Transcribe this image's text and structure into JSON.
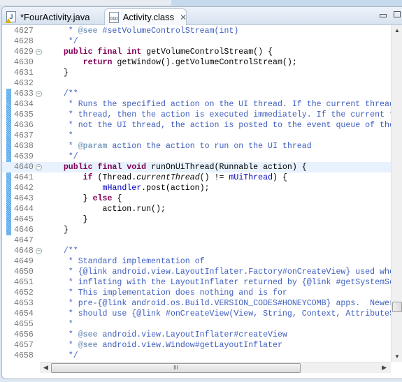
{
  "tabs": [
    {
      "label": "*FourActivity.java",
      "icon": "java-file-warning-icon",
      "active": false
    },
    {
      "label": "Activity.class",
      "icon": "class-file-icon",
      "active": true,
      "close": "✕"
    }
  ],
  "editor": {
    "current_line": 4640,
    "range_indicator": [
      4633,
      4646
    ],
    "folds": [
      4629,
      4633,
      4640,
      4648
    ],
    "lines": [
      {
        "n": "4627",
        "s": [
          [
            "c",
            "     * "
          ],
          [
            "t",
            "@see"
          ],
          [
            "c",
            " #setVolumeControlStream(int)"
          ]
        ]
      },
      {
        "n": "4628",
        "s": [
          [
            "c",
            "     */"
          ]
        ]
      },
      {
        "n": "4629",
        "s": [
          [
            "k",
            "    public final int"
          ],
          [
            "n",
            " getVolumeControlStream() {"
          ]
        ]
      },
      {
        "n": "4630",
        "s": [
          [
            "k",
            "        return"
          ],
          [
            "n",
            " getWindow().getVolumeControlStream();"
          ]
        ]
      },
      {
        "n": "4631",
        "s": [
          [
            "n",
            "    }"
          ]
        ]
      },
      {
        "n": "4632",
        "s": []
      },
      {
        "n": "4633",
        "s": [
          [
            "c",
            "    /**"
          ]
        ]
      },
      {
        "n": "4634",
        "s": [
          [
            "c",
            "     * Runs the specified action on the UI thread. If the current thread is the UI"
          ]
        ]
      },
      {
        "n": "4635",
        "s": [
          [
            "c",
            "     * thread, then the action is executed immediately. If the current thread is"
          ]
        ]
      },
      {
        "n": "4636",
        "s": [
          [
            "c",
            "     * not the UI thread, the action is posted to the event queue of the UI thread."
          ]
        ]
      },
      {
        "n": "4637",
        "s": [
          [
            "c",
            "     *"
          ]
        ]
      },
      {
        "n": "4638",
        "s": [
          [
            "c",
            "     * "
          ],
          [
            "t",
            "@param"
          ],
          [
            "c",
            " action the action to run on the UI thread"
          ]
        ]
      },
      {
        "n": "4639",
        "s": [
          [
            "c",
            "     */"
          ]
        ]
      },
      {
        "n": "4640",
        "s": [
          [
            "k",
            "    public final void"
          ],
          [
            "n",
            " runOnUiThread(Runnable action) {"
          ]
        ]
      },
      {
        "n": "4641",
        "s": [
          [
            "k",
            "        if"
          ],
          [
            "n",
            " (Thread."
          ],
          [
            "i",
            "currentThread"
          ],
          [
            "n",
            "() != "
          ],
          [
            "f",
            "mUiThread"
          ],
          [
            "n",
            ") {"
          ]
        ]
      },
      {
        "n": "4642",
        "s": [
          [
            "f",
            "            mHandler"
          ],
          [
            "n",
            ".post(action);"
          ]
        ]
      },
      {
        "n": "4643",
        "s": [
          [
            "n",
            "        } "
          ],
          [
            "k",
            "else"
          ],
          [
            "n",
            " {"
          ]
        ]
      },
      {
        "n": "4644",
        "s": [
          [
            "n",
            "            action.run();"
          ]
        ]
      },
      {
        "n": "4645",
        "s": [
          [
            "n",
            "        }"
          ]
        ]
      },
      {
        "n": "4646",
        "s": [
          [
            "n",
            "    }"
          ]
        ]
      },
      {
        "n": "4647",
        "s": []
      },
      {
        "n": "4648",
        "s": [
          [
            "c",
            "    /**"
          ]
        ]
      },
      {
        "n": "4649",
        "s": [
          [
            "c",
            "     * Standard implementation of"
          ]
        ]
      },
      {
        "n": "4650",
        "s": [
          [
            "c",
            "     * {@link android.view.LayoutInflater.Factory#onCreateView} used when"
          ]
        ]
      },
      {
        "n": "4651",
        "s": [
          [
            "c",
            "     * inflating with the LayoutInflater returned by {@link #getSystemService}."
          ]
        ]
      },
      {
        "n": "4652",
        "s": [
          [
            "c",
            "     * This implementation does nothing and is for"
          ]
        ]
      },
      {
        "n": "4653",
        "s": [
          [
            "c",
            "     * pre-{@link android.os.Build.VERSION_CODES#HONEYCOMB} apps.  Newer apps"
          ]
        ]
      },
      {
        "n": "4654",
        "s": [
          [
            "c",
            "     * should use {@link #onCreateView(View, String, Context, AttributeSet)}."
          ]
        ]
      },
      {
        "n": "4655",
        "s": [
          [
            "c",
            "     *"
          ]
        ]
      },
      {
        "n": "4656",
        "s": [
          [
            "c",
            "     * "
          ],
          [
            "t",
            "@see"
          ],
          [
            "c",
            " android.view.LayoutInflater#createView"
          ]
        ]
      },
      {
        "n": "4657",
        "s": [
          [
            "c",
            "     * "
          ],
          [
            "t",
            "@see"
          ],
          [
            "c",
            " android.view.Window#getLayoutInflater"
          ]
        ]
      },
      {
        "n": "4658",
        "s": [
          [
            "c",
            "     */"
          ]
        ]
      }
    ]
  },
  "colors": {
    "keyword": "#7f0055",
    "javadoc": "#3f5fbf",
    "javadoc_tag": "#7f9fbf",
    "field": "#0000c0",
    "current_line": "#e8f2fe",
    "range": "#4aa0e8"
  },
  "scrollbars": {
    "h_thumb_grip": "III"
  }
}
